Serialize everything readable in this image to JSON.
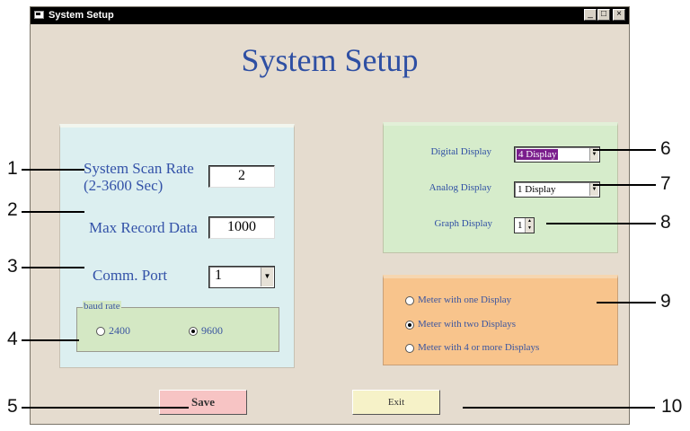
{
  "window": {
    "title": "System Setup",
    "buttons": {
      "minimize": "_",
      "maximize": "□",
      "close": "×"
    }
  },
  "heading": "System Setup",
  "left_panel": {
    "scan_rate": {
      "label_line1": "System Scan Rate",
      "label_line2": "(2-3600  Sec)",
      "value": "2"
    },
    "max_record": {
      "label": "Max Record Data",
      "value": "1000"
    },
    "comm_port": {
      "label": "Comm. Port",
      "value": "1"
    },
    "baud_rate": {
      "legend": "baud rate",
      "options": [
        {
          "label": "2400",
          "selected": false
        },
        {
          "label": "9600",
          "selected": true
        }
      ]
    }
  },
  "display_panel": {
    "digital": {
      "label": "Digital Display",
      "value": "4 Display"
    },
    "analog": {
      "label": "Analog Display",
      "value": "1 Display"
    },
    "graph": {
      "label": "Graph Display",
      "value": "1"
    }
  },
  "meter_panel": {
    "options": [
      {
        "label": "Meter with one Display",
        "selected": false
      },
      {
        "label": "Meter with two Displays",
        "selected": true
      },
      {
        "label": "Meter with 4 or more Displays",
        "selected": false
      }
    ]
  },
  "buttons": {
    "save": "Save",
    "exit": "Exit"
  },
  "callouts": [
    "1",
    "2",
    "3",
    "4",
    "5",
    "6",
    "7",
    "8",
    "9",
    "10"
  ],
  "colors": {
    "heading": "#2e4fa3",
    "left_panel_bg": "#dceff0",
    "display_panel_bg": "#d6eccb",
    "meter_panel_bg": "#f8c48c",
    "save_bg": "#f7c4c4",
    "exit_bg": "#f6f2c8"
  }
}
